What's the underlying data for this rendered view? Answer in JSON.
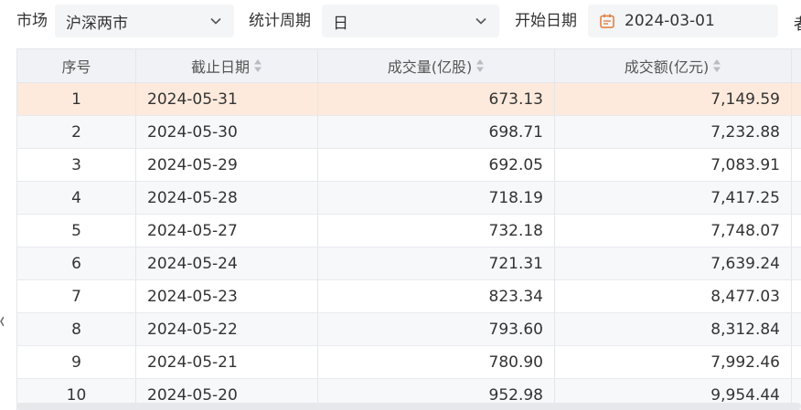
{
  "filters": {
    "market_label": "市场",
    "market_value": "沪深两市",
    "period_label": "统计周期",
    "period_value": "日",
    "start_label": "开始日期",
    "start_value": "2024-03-01",
    "next_label_fragment": "者"
  },
  "table": {
    "headers": {
      "index": "序号",
      "date": "截止日期",
      "volume": "成交量(亿股)",
      "amount": "成交额(亿元)"
    },
    "rows": [
      {
        "index": "1",
        "date": "2024-05-31",
        "volume": "673.13",
        "amount": "7,149.59"
      },
      {
        "index": "2",
        "date": "2024-05-30",
        "volume": "698.71",
        "amount": "7,232.88"
      },
      {
        "index": "3",
        "date": "2024-05-29",
        "volume": "692.05",
        "amount": "7,083.91"
      },
      {
        "index": "4",
        "date": "2024-05-28",
        "volume": "718.19",
        "amount": "7,417.25"
      },
      {
        "index": "5",
        "date": "2024-05-27",
        "volume": "732.18",
        "amount": "7,748.07"
      },
      {
        "index": "6",
        "date": "2024-05-24",
        "volume": "721.31",
        "amount": "7,639.24"
      },
      {
        "index": "7",
        "date": "2024-05-23",
        "volume": "823.34",
        "amount": "8,477.03"
      },
      {
        "index": "8",
        "date": "2024-05-22",
        "volume": "793.60",
        "amount": "8,312.84"
      },
      {
        "index": "9",
        "date": "2024-05-21",
        "volume": "780.90",
        "amount": "7,992.46"
      },
      {
        "index": "10",
        "date": "2024-05-20",
        "volume": "952.98",
        "amount": "9,954.44"
      }
    ]
  },
  "colors": {
    "highlight_row": "#fdeadc",
    "header_bg": "#f0f2f5",
    "select_bg": "#f4f5f7",
    "calendar_accent": "#e07b39"
  }
}
